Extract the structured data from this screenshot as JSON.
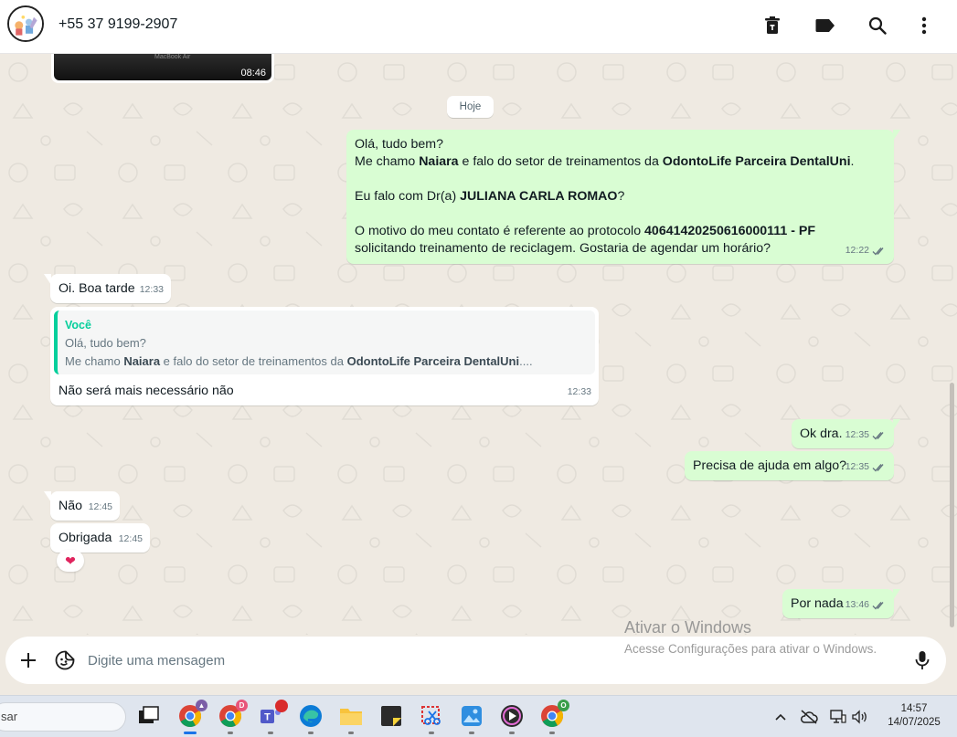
{
  "header": {
    "contact_name": "+55 37 9199-2907",
    "icons": [
      "delete-icon",
      "label-icon",
      "search-icon",
      "menu-icon"
    ]
  },
  "chat": {
    "video": {
      "brand_text": "MacBook Air",
      "duration": "08:46"
    },
    "date_chip": "Hoje",
    "messages": [
      {
        "direction": "out",
        "time": "12:22",
        "status": "read",
        "lines": {
          "l1": "Olá, tudo bem?",
          "l2a": "Me chamo ",
          "l2b": "Naiara",
          "l2c": " e falo do setor de treinamentos da ",
          "l2d": "OdontoLife Parceira DentalUni",
          "l2e": ".",
          "l3a": "Eu falo com Dr(a) ",
          "l3b": "JULIANA CARLA ROMAO",
          "l3c": "?",
          "l4a": "O motivo do meu contato é referente ao protocolo ",
          "l4b": "40641420250616000111 - PF",
          "l5": "solicitando treinamento de reciclagem. Gostaria de agendar um horário?"
        }
      },
      {
        "direction": "in",
        "text": "Oi. Boa tarde",
        "time": "12:33"
      },
      {
        "direction": "in",
        "time": "12:33",
        "quote": {
          "author": "Você",
          "line1": "Olá, tudo bem?",
          "line2a": "Me chamo ",
          "line2b": "Naiara",
          "line2c": " e falo do setor de treinamentos da ",
          "line2d": "OdontoLife Parceira DentalUni",
          "line2e": "...."
        },
        "text": "Não será mais necessário não"
      },
      {
        "direction": "out",
        "text": "Ok dra.",
        "time": "12:35",
        "status": "read"
      },
      {
        "direction": "out",
        "text": "Precisa de ajuda em algo?",
        "time": "12:35",
        "status": "read"
      },
      {
        "direction": "in",
        "text": "Não",
        "time": "12:45"
      },
      {
        "direction": "in",
        "text": "Obrigada",
        "time": "12:45",
        "reaction": "❤"
      },
      {
        "direction": "out",
        "text": "Por nada",
        "time": "13:46",
        "status": "read"
      }
    ],
    "watermark": {
      "title": "Ativar o Windows",
      "subtitle": "Acesse Configurações para ativar o Windows."
    }
  },
  "composer": {
    "placeholder": "Digite uma mensagem",
    "icons": [
      "plus-icon",
      "sticker-icon",
      "microphone-icon"
    ]
  },
  "taskbar": {
    "search_text": "sar",
    "apps": [
      {
        "name": "task-view",
        "badge": ""
      },
      {
        "name": "chrome-profile-1",
        "badge": ""
      },
      {
        "name": "chrome-profile-2",
        "badge": "D"
      },
      {
        "name": "teams",
        "badge": ""
      },
      {
        "name": "edge",
        "badge": ""
      },
      {
        "name": "file-explorer",
        "badge": ""
      },
      {
        "name": "sticky-app",
        "badge": ""
      },
      {
        "name": "snipping-tool",
        "badge": ""
      },
      {
        "name": "photos",
        "badge": ""
      },
      {
        "name": "media-player",
        "badge": ""
      },
      {
        "name": "chrome-profile-3",
        "badge": "O"
      }
    ],
    "clock": {
      "time": "14:57",
      "date": "14/07/2025"
    },
    "colors": {
      "accent": "#1a73e8"
    }
  },
  "colors": {
    "chat_bg": "#efeae2",
    "outgoing_bubble": "#d9fdd3",
    "incoming_bubble": "#ffffff",
    "read_ticks": "#667781",
    "quote_accent": "#06cf9c"
  }
}
